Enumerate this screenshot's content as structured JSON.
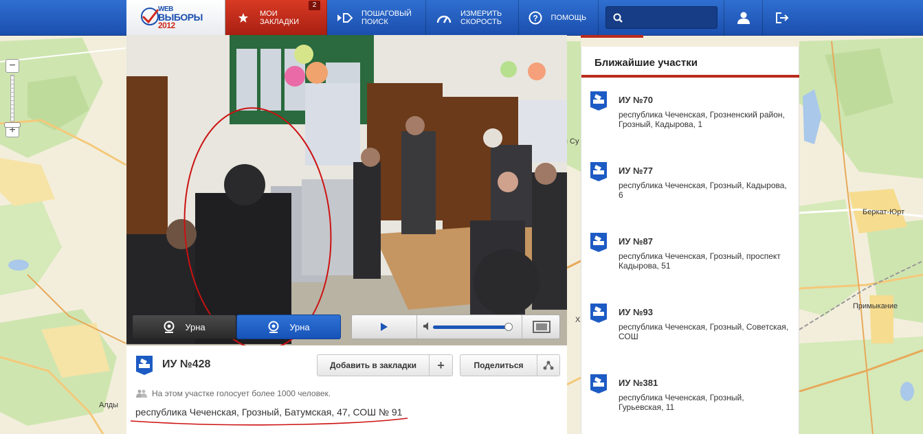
{
  "logo": {
    "line1": "WEB",
    "line2": "ВЫБОРЫ",
    "line3": "2012"
  },
  "nav": {
    "bookmarks_label": "МОИ ЗАКЛАДКИ",
    "bookmarks_count": "2",
    "step_search_label": "ПОШАГОВЫЙ ПОИСК",
    "speed_label": "ИЗМЕРИТЬ СКОРОСТЬ",
    "help_label": "ПОМОЩЬ"
  },
  "search": {
    "value": "",
    "placeholder": ""
  },
  "map_labels": {
    "berkat": "Беркат-Юрт",
    "primykanie": "Примыкание",
    "aldy": "Алды",
    "su": "я Су",
    "x": "Х"
  },
  "video": {
    "camera_tabs": [
      "Урна",
      "Урна"
    ],
    "active_camera": 1,
    "volume": 0.93
  },
  "station_info": {
    "title": "ИУ №428",
    "add_bookmark_label": "Добавить в закладки",
    "add_bookmark_plus": "+",
    "share_label": "Поделиться",
    "voters_text": "На этом участке голосует более 1000 человек.",
    "address": "республика Чеченская, Грозный, Батумская, 47, СОШ № 91"
  },
  "nearby": {
    "title": "Ближайшие участки",
    "items": [
      {
        "name": "ИУ №70",
        "address": "республика Чеченская, Грозненский район, Грозный, Кадырова, 1"
      },
      {
        "name": "ИУ №77",
        "address": "республика Чеченская, Грозный, Кадырова, 6"
      },
      {
        "name": "ИУ №87",
        "address": "республика Чеченская, Грозный, проспект Кадырова, 51"
      },
      {
        "name": "ИУ №93",
        "address": "республика Чеченская, Грозный, Советская, СОШ"
      },
      {
        "name": "ИУ №381",
        "address": "республика Чеченская, Грозный, Гурьевская, 11"
      }
    ]
  },
  "colors": {
    "brand_blue": "#1b4fae",
    "accent_red": "#b92b1b",
    "annotation_red": "#cc1111"
  }
}
